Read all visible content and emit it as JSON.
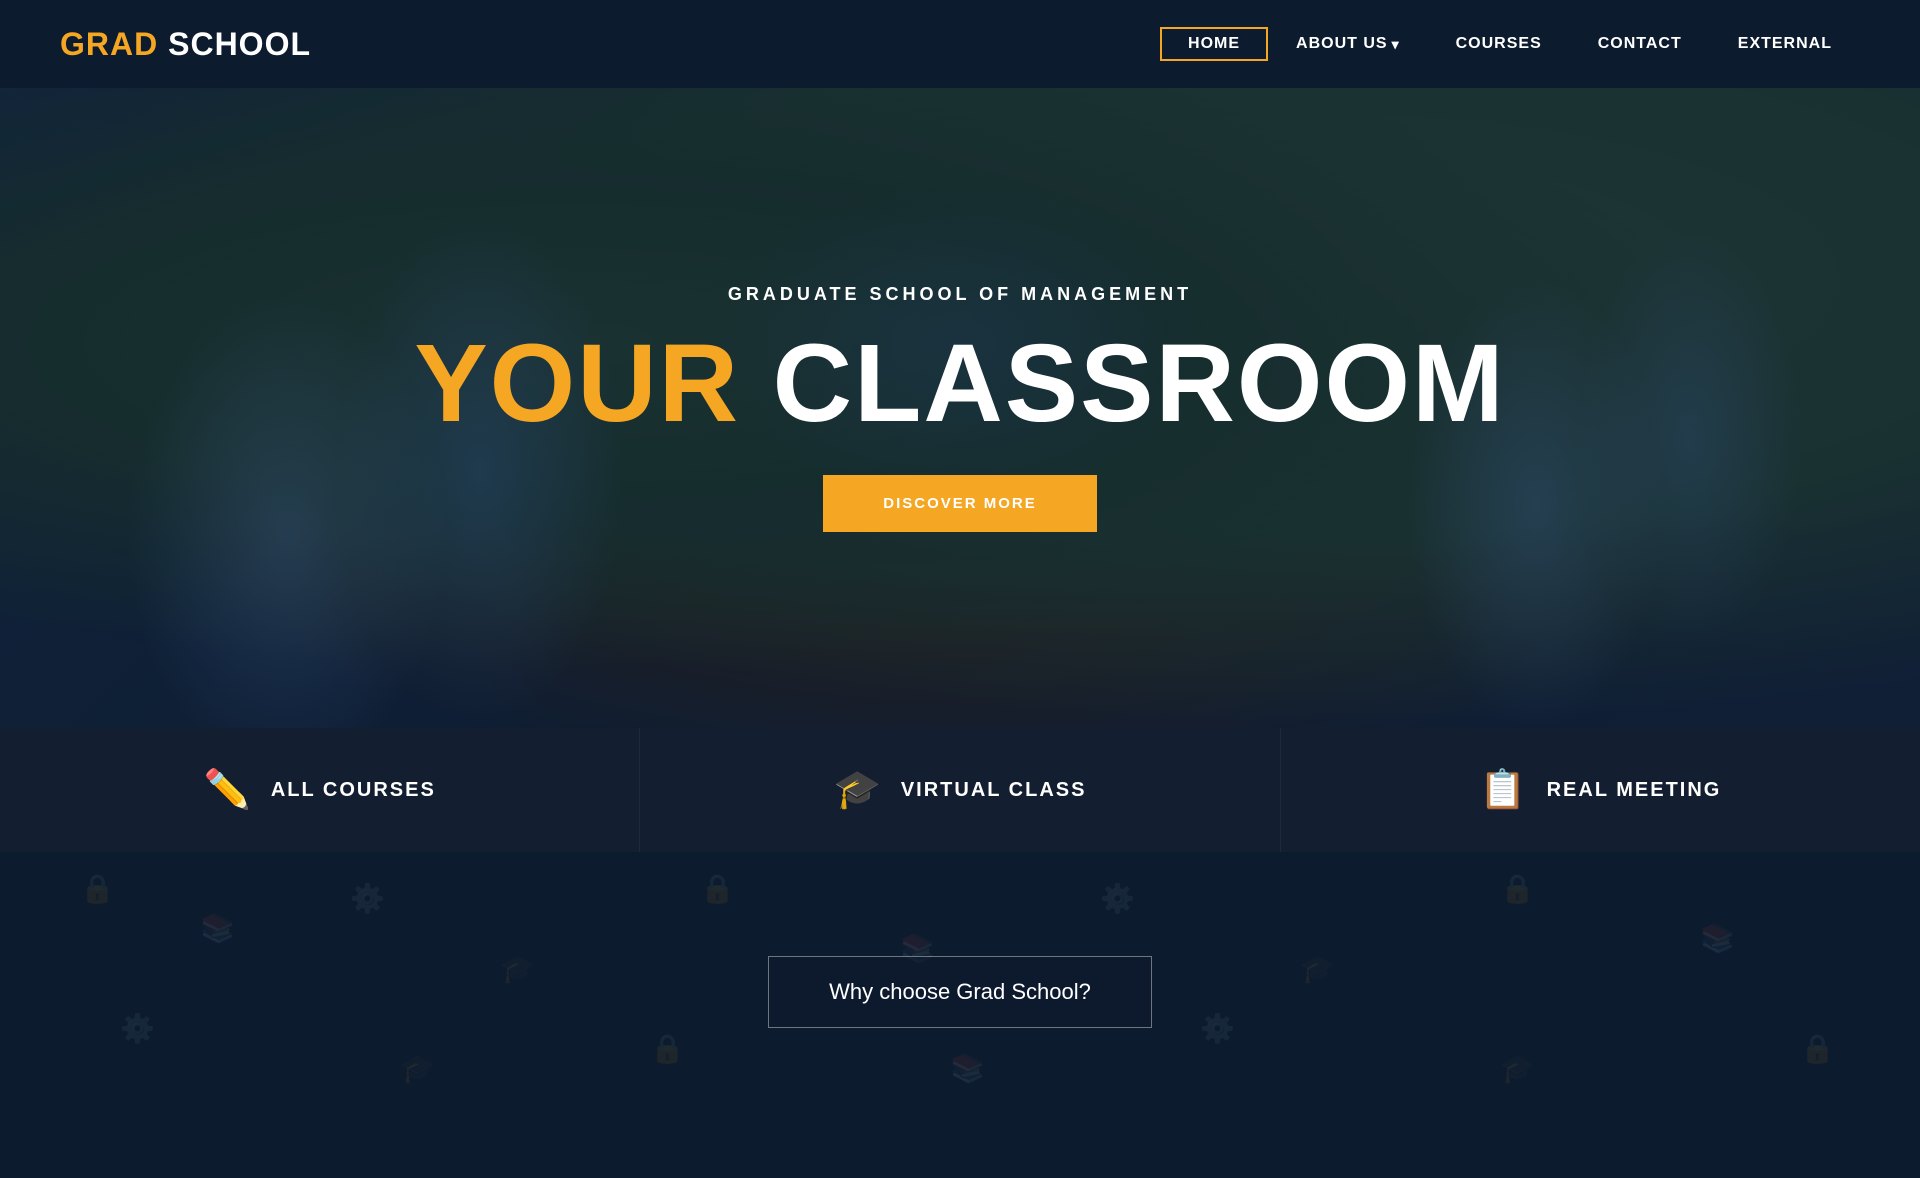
{
  "logo": {
    "grad": "GRAD",
    "school": " SCHOOL"
  },
  "nav": {
    "items": [
      {
        "label": "HOME",
        "active": true,
        "hasDropdown": false
      },
      {
        "label": "ABOUT US",
        "active": false,
        "hasDropdown": true
      },
      {
        "label": "COURSES",
        "active": false,
        "hasDropdown": false
      },
      {
        "label": "CONTACT",
        "active": false,
        "hasDropdown": false
      },
      {
        "label": "EXTERNAL",
        "active": false,
        "hasDropdown": false
      }
    ]
  },
  "hero": {
    "subtitle": "GRADUATE SCHOOL OF MANAGEMENT",
    "title_your": "YOUR",
    "title_classroom": " CLASSROOM",
    "button_label": "DISCOVER MORE"
  },
  "cards": [
    {
      "icon": "✏️",
      "label": "ALL COURSES"
    },
    {
      "icon": "🎓",
      "label": "VIRTUAL CLASS"
    },
    {
      "icon": "📋",
      "label": "REAL MEETING"
    }
  ],
  "bottom": {
    "why_label": "Why choose Grad School?"
  },
  "colors": {
    "accent": "#f5a623",
    "dark": "#0d1b2e",
    "card_bg": "#131e30",
    "text_white": "#ffffff"
  }
}
